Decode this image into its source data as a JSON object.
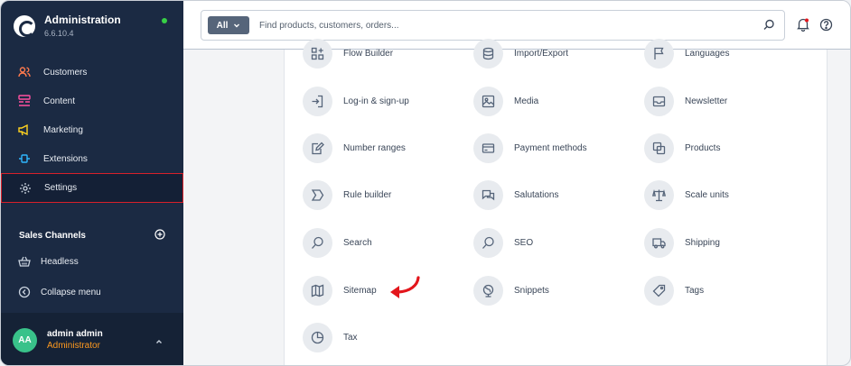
{
  "app": {
    "title": "Administration",
    "version": "6.6.10.4"
  },
  "sidebar": {
    "items": [
      {
        "label": "Customers",
        "icon": "customers-icon",
        "color": "#ff7a4d"
      },
      {
        "label": "Content",
        "icon": "content-icon",
        "color": "#ff4fa0"
      },
      {
        "label": "Marketing",
        "icon": "marketing-icon",
        "color": "#ffd21f"
      },
      {
        "label": "Extensions",
        "icon": "extensions-icon",
        "color": "#2fb7ff"
      },
      {
        "label": "Settings",
        "icon": "gear-icon",
        "color": "#c9d2de",
        "active": true
      }
    ],
    "sales_channels_label": "Sales Channels",
    "sales_channel_item": "Headless",
    "collapse_label": "Collapse menu"
  },
  "user": {
    "initials": "AA",
    "name": "admin admin",
    "role": "Administrator"
  },
  "search": {
    "filter_label": "All",
    "placeholder": "Find products, customers, orders..."
  },
  "settings_grid": {
    "row0": [
      "Flow Builder",
      "Import/Export",
      "Languages"
    ],
    "row1": [
      "Log-in & sign-up",
      "Media",
      "Newsletter"
    ],
    "row2": [
      "Number ranges",
      "Payment methods",
      "Products"
    ],
    "row3": [
      "Rule builder",
      "Salutations",
      "Scale units"
    ],
    "row4": [
      "Search",
      "SEO",
      "Shipping"
    ],
    "row5": [
      "Sitemap",
      "Snippets",
      "Tags"
    ],
    "row6": [
      "Tax"
    ]
  },
  "colors": {
    "sidebar_bg": "#1b2a43",
    "active_border": "#d9202a",
    "role_color": "#ff9a1f",
    "annotation_arrow": "#e3161c"
  }
}
